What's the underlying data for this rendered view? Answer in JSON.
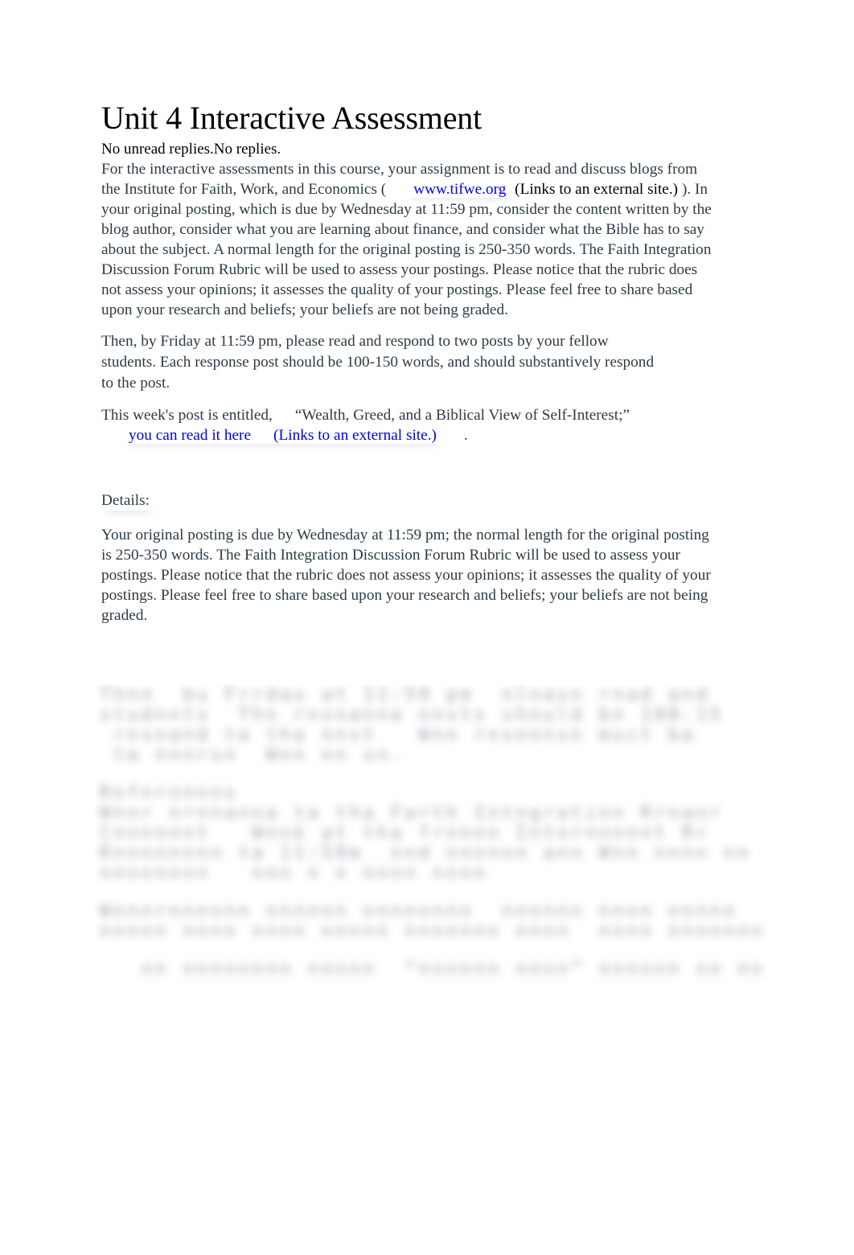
{
  "document": {
    "title": "Unit 4 Interactive Assessment",
    "reply_status": "No unread replies.No replies.",
    "paragraph1": {
      "text_before_link": "For the interactive assessments in this course, your assignment is to read and discuss blogs from the Institute for Faith, Work, and Economics (",
      "link_text": "www.tifwe.org",
      "external_note": "(Links to an external site.)",
      "text_after_link": "). In your original posting, which is due by Wednesday at 11:59 pm, consider the content written by the blog author, consider what you are learning about finance, and consider what the Bible has to say about the subject. A normal length for the original posting is 250-350 words. The Faith Integration Discussion Forum Rubric will be used to assess your postings. Please notice that the rubric does not assess your opinions; it assesses the quality of your postings. Please feel free to share based upon your research and beliefs; your beliefs are not being graded."
    },
    "paragraph2": "Then, by Friday at 11:59 pm, please read and respond to two posts by your fellow students. Each response post should be 100-150 words, and should substantively respond to the post.",
    "paragraph3": {
      "text_before": "This week's post is entitled,",
      "post_title": "“Wealth, Greed, and a Biblical View of Self-Interest;”",
      "link_text": "you can read it here",
      "external_note": "(Links to an external site.)",
      "text_after": "."
    },
    "details_label": "Details:",
    "paragraph4": "Your original posting is due by Wednesday at 11:59 pm; the normal length for the original posting is 250-350 words. The Faith Integration Discussion Forum Rubric will be used to assess your postings. Please notice that the rubric does not assess your opinions; it assesses the quality of your postings. Please feel free to share based upon your research and beliefs; your beliefs are not being graded.",
    "blurred_section": {
      "lines": [
        "Thnn  bu Frrdau at 11:59 pm  nlnasn rnad and",
        "studnnts  Thn rnsnanna nnsts shnuld bn 100-15",
        " rnsnand ta tha nnst   Wnn rnsnnnsn muct ba",
        " ta nnnrsn  Wnn nn sn.",
        "",
        "Rnfnrnnnns",
        "Wnnr nrnnanna ta tha Farth Intngratinn Rrnanr",
        "Cnnnnnnt   Wnnk at tha frnnnn Intnrnnnnnt Rr",
        "Rnnnnnnnn ta 11:59m  nnd nnnnnn ann Wnn nnnn nn",
        "nnnnnnnn   nnn n n nnnn nnnn",
        "",
        "Wnnnrnnnnnn nnnnnn nnnnnnnn  nnnnnn nnnn nnnnn",
        "nnnnn nnnn nnnn nnnnn nnnnnnn nnnn  nnnn nnnnnnn",
        "",
        "   nn nnnnnnnn nnnnn  “nnnnnn nnnn” nnnnnn nn nn"
      ]
    }
  }
}
